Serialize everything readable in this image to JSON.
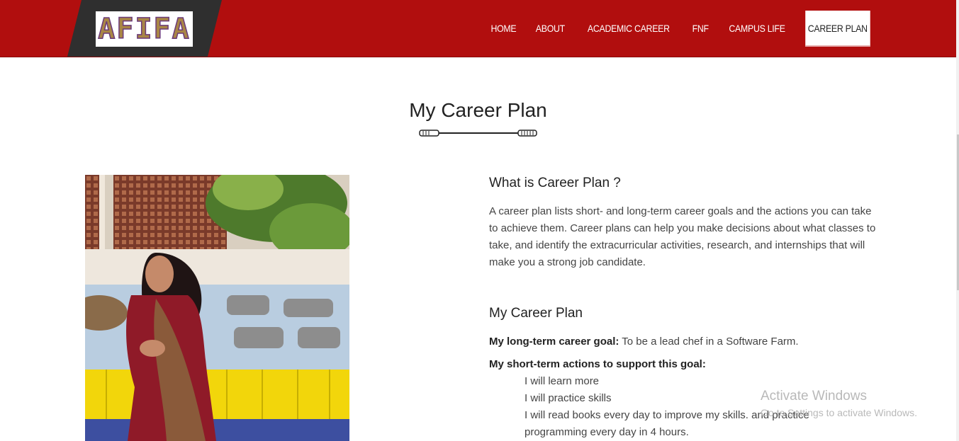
{
  "logo": {
    "text": "AFIFA"
  },
  "nav": {
    "items": [
      {
        "label": "HOME"
      },
      {
        "label": "ABOUT"
      },
      {
        "label": "ACADEMIC CAREER"
      },
      {
        "label": "FNF"
      },
      {
        "label": "CAMPUS LIFE"
      },
      {
        "label": "CAREER PLAN"
      }
    ],
    "active": "CAREER PLAN"
  },
  "page": {
    "title": "My Career Plan"
  },
  "what": {
    "heading": "What is Career Plan ?",
    "text": "A career plan lists short- and long-term career goals and the actions you can take to achieve them. Career plans can help you make decisions about what classes to take, and identify the extracurricular activities, research, and internships that will make you a strong job candidate."
  },
  "plan": {
    "heading": "My Career Plan",
    "long_term_label": "My long-term career goal:",
    "long_term_value": "To be a lead chef in a Software Farm.",
    "short_term_label": "My short-term actions to support this goal:",
    "actions": [
      "I will learn more",
      "I will practice skills",
      "I will read books every day to improve my skills. and practice programming every day in 4 hours."
    ]
  },
  "watermark": {
    "title": "Activate Windows",
    "subtitle": "Go to Settings to activate Windows."
  },
  "colors": {
    "navbar": "#b10e0e",
    "logo_panel": "#2f2f2f",
    "logo_text": "#a98645"
  }
}
